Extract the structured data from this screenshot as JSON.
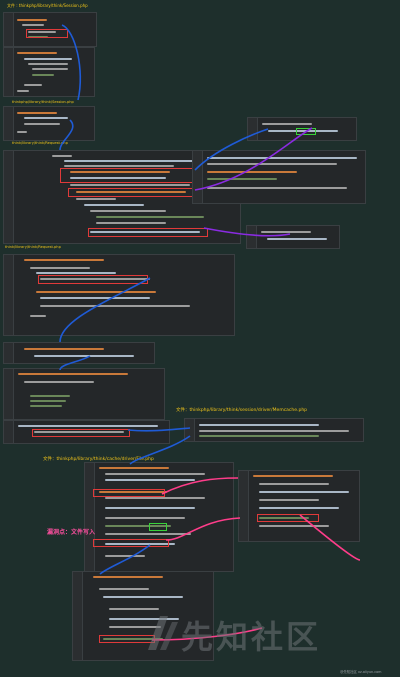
{
  "labels": {
    "file_app_index": "文件 : thinkphp/library/think/Session.php",
    "file_session_php": "thinkphp/library/think/Session.php",
    "file_request_php": "think/library/think/Request.php",
    "file_driver_file": "文件：thinkphp/library/think/cache/driver/File.php",
    "file_driver_memcache": "文件：thinkphp/library/think/session/driver/Memcache.php",
    "vuln_point": "漏洞点：文件写入",
    "footer": "@先知社区 xz.aliyun.com"
  },
  "watermark": {
    "text": "先知社区",
    "logo_icon": "xianzhi-logo"
  },
  "colors": {
    "background": "#1e2f2c",
    "panel": "#242729",
    "highlight_red": "#e03a3a",
    "highlight_green": "#39d13a",
    "arrow_blue": "#1f5bd6",
    "arrow_purple": "#8a2be2",
    "arrow_pink": "#ff3d8a",
    "label_yellow": "#f0c419",
    "label_pink": "#ff4fa0"
  }
}
